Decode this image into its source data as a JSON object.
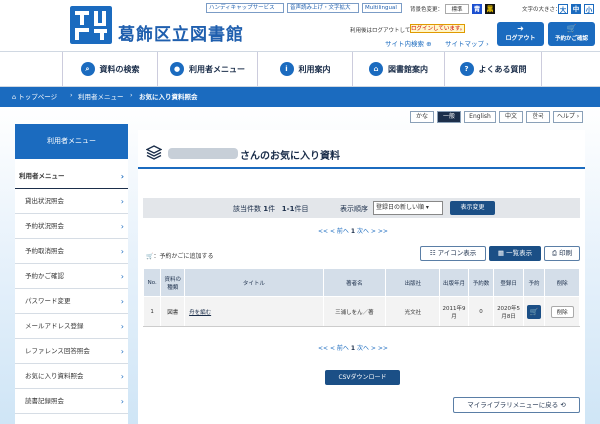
{
  "header": {
    "site_title": "葛飾区立図書館",
    "top_links": [
      "ハンディキャップサービス",
      "音声読み上げ・文字拡大",
      "Multilingual"
    ],
    "bg_color_label": "背景色変更：",
    "bg_options": [
      "標準",
      "青",
      "黒"
    ],
    "font_size_label": "文字の大きさ：",
    "font_sizes": [
      "大",
      "中",
      "小"
    ],
    "logout_notice": "利用後はログアウトしてください。",
    "login_status": "ログインしています。",
    "site_search": "サイト内検索",
    "sitemap": "サイトマップ",
    "logout_label": "ログアウト",
    "cart_label": "予約かご確認"
  },
  "nav": {
    "items": [
      {
        "label": "資料の検索",
        "icon": "search-icon"
      },
      {
        "label": "利用者メニュー",
        "icon": "user-icon"
      },
      {
        "label": "利用案内",
        "icon": "info-icon"
      },
      {
        "label": "図書館案内",
        "icon": "library-icon"
      },
      {
        "label": "よくある質問",
        "icon": "question-icon"
      }
    ]
  },
  "breadcrumb": {
    "home": "トップページ",
    "level1": "利用者メニュー",
    "current": "お気に入り資料照会"
  },
  "languages": [
    "かな",
    "一般",
    "English",
    "中文",
    "한국",
    "ヘルプ"
  ],
  "sidebar": {
    "header": "利用者メニュー",
    "section": "利用者メニュー",
    "items": [
      "貸出状況照会",
      "予約状況照会",
      "予約取消照会",
      "予約かご確認",
      "パスワード変更",
      "メールアドレス登録",
      "レファレンス回答照会",
      "お気に入り資料照会",
      "読書記録照会"
    ]
  },
  "page": {
    "title_suffix": "さんのお気に入り資料"
  },
  "sortbar": {
    "count_label": "該当件数",
    "count_value": "1",
    "count_unit": "件",
    "range": "1-1",
    "range_unit": "件目",
    "order_label": "表示順序",
    "order_value": "登録日の新しい順",
    "change_label": "表示変更"
  },
  "pagination": {
    "first": "<<",
    "prev": "< 前へ",
    "current": "1",
    "next": "次へ >",
    "last": ">>"
  },
  "actions": {
    "add_cart": "：予約かごに追加する",
    "icon_view": "アイコン表示",
    "list_view": "一覧表示",
    "print": "印刷"
  },
  "table": {
    "headers": [
      "No.",
      "資料の種類",
      "タイトル",
      "著者名",
      "出版社",
      "出版年月",
      "予約数",
      "登録日",
      "予約",
      "削除"
    ],
    "rows": [
      {
        "no": "1",
        "type": "図書",
        "title": "舟を編む",
        "author": "三浦しをん／著",
        "publisher": "光文社",
        "pub_date": "2011年9月",
        "reservations": "0",
        "registered": "2020年5月8日",
        "delete": "削除"
      }
    ]
  },
  "csv_label": "CSVダウンロード",
  "mylib_label": "マイライブラリメニューに戻る",
  "colors": {
    "primary": "#1b6bbf",
    "dark_btn": "#1b4f86",
    "table_header": "#d4dee9"
  }
}
